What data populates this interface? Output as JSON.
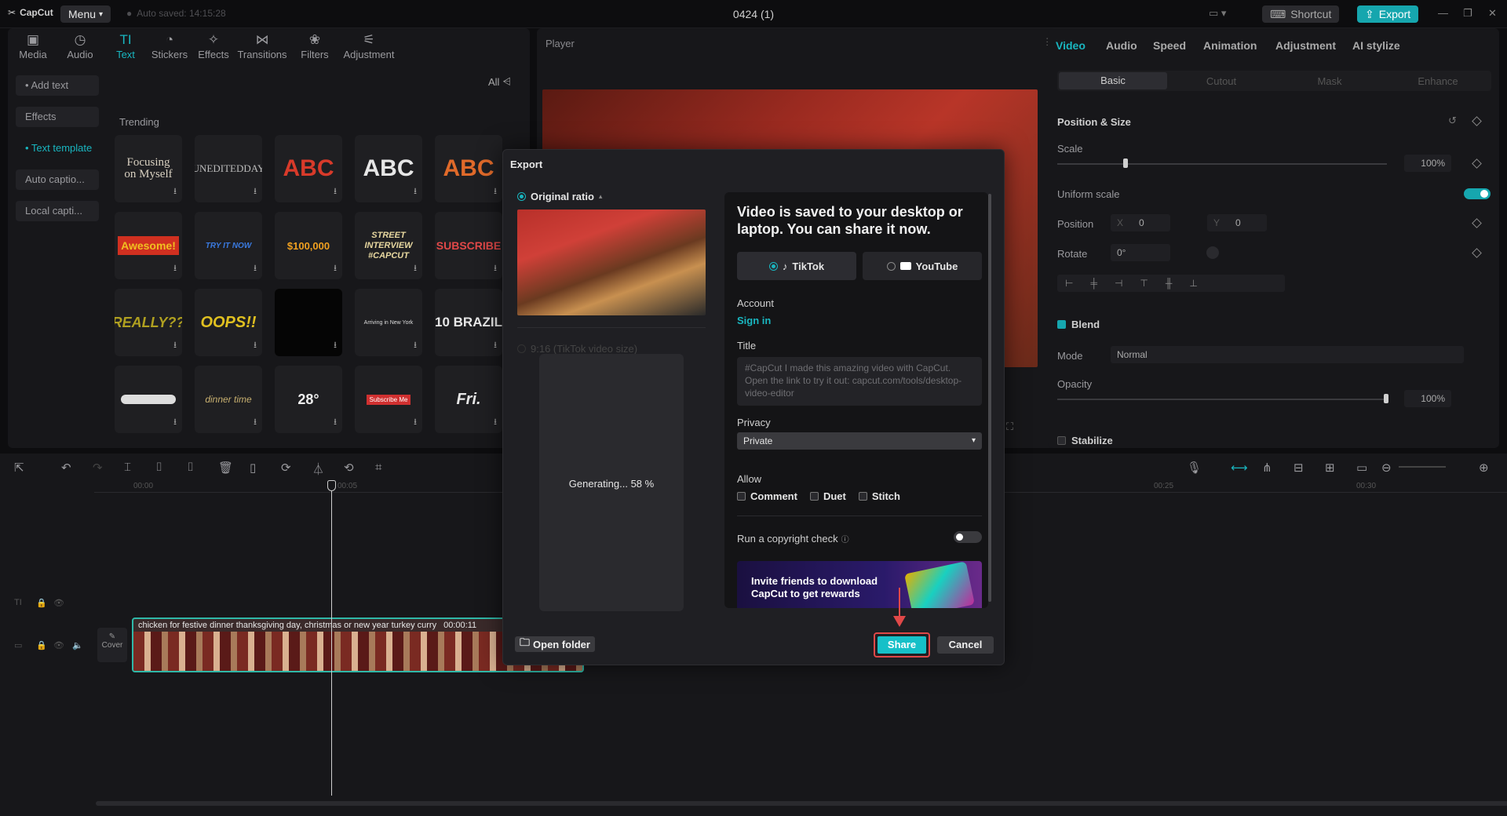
{
  "app": {
    "name": "CapCut",
    "menu_label": "Menu",
    "autosave": "Auto saved: 14:15:28",
    "project_title": "0424 (1)",
    "shortcut_label": "Shortcut",
    "export_label": "Export",
    "accent": "#19b6c0"
  },
  "tools": [
    {
      "label": "Media",
      "icon": "media-icon"
    },
    {
      "label": "Audio",
      "icon": "audio-icon"
    },
    {
      "label": "Text",
      "icon": "text-icon"
    },
    {
      "label": "Stickers",
      "icon": "stickers-icon"
    },
    {
      "label": "Effects",
      "icon": "effects-icon"
    },
    {
      "label": "Transitions",
      "icon": "transitions-icon"
    },
    {
      "label": "Filters",
      "icon": "filters-icon"
    },
    {
      "label": "Adjustment",
      "icon": "adjustment-icon"
    }
  ],
  "sidebar": [
    "• Add text",
    "Effects",
    "• Text template",
    "Auto captio...",
    "Local capti..."
  ],
  "filter_label": "All",
  "trending_label": "Trending",
  "templates": [
    "Focusing on Myself",
    "UNEDITEDDAY",
    "ABC",
    "ABC",
    "ABC",
    "Awesome!",
    "TRY IT NOW",
    "$100,000",
    "STREET INTERVIEW #CAPCUT",
    "SUBSCRIBE",
    "REALLY??",
    "OOPS!!",
    "",
    "Arriving in New York",
    "10 BRAZIL",
    "",
    "dinner time",
    "28°",
    "Subscribe Me",
    "Fri."
  ],
  "player": {
    "label": "Player"
  },
  "props": {
    "tabs": [
      "Video",
      "Audio",
      "Speed",
      "Animation",
      "Adjustment",
      "AI stylize"
    ],
    "subtabs": [
      "Basic",
      "Cutout",
      "Mask",
      "Enhance"
    ],
    "position_size": "Position & Size",
    "scale_label": "Scale",
    "scale_value": "100%",
    "uniform_scale": "Uniform scale",
    "position_label": "Position",
    "pos_x_label": "X",
    "pos_x": "0",
    "pos_y_label": "Y",
    "pos_y": "0",
    "rotate_label": "Rotate",
    "rotate_value": "0°",
    "blend": "Blend",
    "mode_label": "Mode",
    "mode_value": "Normal",
    "opacity_label": "Opacity",
    "opacity_value": "100%",
    "stabilize": "Stabilize"
  },
  "timeline": {
    "ticks": [
      "00:00",
      "00:05",
      "00:25",
      "00:30"
    ],
    "cover_label": "Cover",
    "clip_label": "chicken for festive dinner thanksgiving day, christmas or new year turkey curry",
    "clip_time": "00:00:11"
  },
  "export": {
    "title": "Export",
    "original_ratio": "Original ratio",
    "ratio2": "9:16 (TikTok video size)",
    "generating": "Generating... 58 %",
    "saved_msg": "Video is saved to your desktop or laptop. You can share it now.",
    "platforms": [
      "TikTok",
      "YouTube"
    ],
    "account_label": "Account",
    "signin": "Sign in",
    "title_label": "Title",
    "title_placeholder": "#CapCut I made this amazing video with CapCut. Open the link to try it out: capcut.com/tools/desktop-video-editor",
    "privacy_label": "Privacy",
    "privacy_value": "Private",
    "allow_label": "Allow",
    "allow_options": [
      "Comment",
      "Duet",
      "Stitch"
    ],
    "copyright_label": "Run a copyright check",
    "banner_text": "Invite friends to download CapCut to get rewards",
    "open_folder": "Open folder",
    "share": "Share",
    "cancel": "Cancel"
  }
}
